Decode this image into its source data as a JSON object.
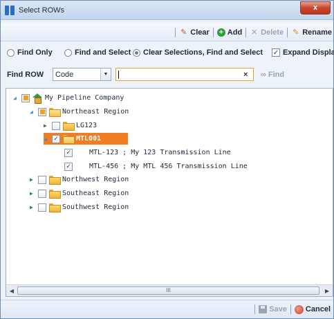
{
  "window": {
    "title": "Select ROWs",
    "close_label": "x"
  },
  "toolbar": {
    "clear_label": "Clear",
    "add_label": "Add",
    "delete_label": "Delete",
    "rename_label": "Rename"
  },
  "options": {
    "find_only_label": "Find Only",
    "find_and_select_label": "Find and Select",
    "clear_find_select_label": "Clear Selections, Find and Select",
    "selected_mode": "clear_find_select",
    "expand_display_label": "Expand Display",
    "expand_display_checked": true
  },
  "find": {
    "label": "Find ROW",
    "field_value": "Code",
    "search_value": "",
    "clear_symbol": "×",
    "find_label": "Find"
  },
  "tree": {
    "root": {
      "label": "My Pipeline Company",
      "state": "partial",
      "expanded": true
    },
    "items": [
      {
        "label": "Northeast Region",
        "state": "partial",
        "expanded": true
      },
      {
        "label": "LG123",
        "state": "unchecked",
        "expanded": false
      },
      {
        "label": "MTL001",
        "state": "checked",
        "expanded": true,
        "selected": true
      },
      {
        "label": "MTL-123 ; My 123 Transmission Line",
        "state": "checked"
      },
      {
        "label": "MTL-456 ; My MTL 456 Transmission Line",
        "state": "checked"
      },
      {
        "label": "Northwest Region",
        "state": "unchecked",
        "expanded": false
      },
      {
        "label": "Southeast Region",
        "state": "unchecked",
        "expanded": false
      },
      {
        "label": "Southwest Region",
        "state": "unchecked",
        "expanded": false
      }
    ]
  },
  "scrollbar": {
    "thumb_grip": "III"
  },
  "bottom": {
    "save_label": "Save",
    "cancel_label": "Cancel"
  },
  "colors": {
    "selection": "#f07d22",
    "title_bar": "#c2d6ee",
    "close_button": "#c8452b",
    "add_icon": "#2f9a3a",
    "folder": "#f1b437"
  }
}
